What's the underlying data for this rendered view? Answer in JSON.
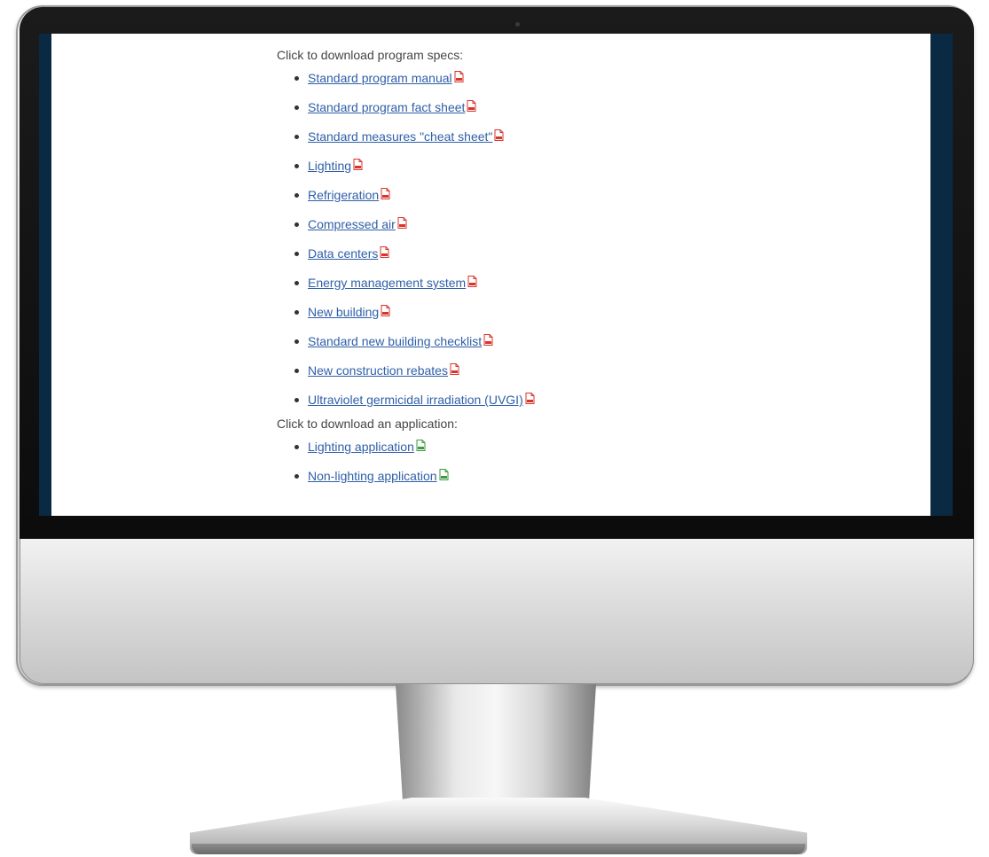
{
  "page": {
    "spec_intro": "Click to download program specs:",
    "application_intro": "Click to download an application:"
  },
  "spec_links": [
    {
      "label": "Standard program manual",
      "icon": "pdf-file-icon"
    },
    {
      "label": "Standard program fact sheet",
      "icon": "pdf-file-icon"
    },
    {
      "label": "Standard measures \"cheat sheet\"",
      "icon": "pdf-file-icon"
    },
    {
      "label": "Lighting",
      "icon": "pdf-file-icon"
    },
    {
      "label": "Refrigeration",
      "icon": "pdf-file-icon"
    },
    {
      "label": "Compressed air",
      "icon": "pdf-file-icon"
    },
    {
      "label": "Data centers",
      "icon": "pdf-file-icon"
    },
    {
      "label": "Energy management system",
      "icon": "pdf-file-icon"
    },
    {
      "label": "New building",
      "icon": "pdf-file-icon"
    },
    {
      "label": "Standard new building checklist",
      "icon": "pdf-file-icon"
    },
    {
      "label": "New construction rebates",
      "icon": "pdf-file-icon"
    },
    {
      "label": "Ultraviolet germicidal irradiation (UVGI)",
      "icon": "pdf-file-icon"
    }
  ],
  "application_links": [
    {
      "label": "Lighting application",
      "icon": "spreadsheet-file-icon"
    },
    {
      "label": "Non-lighting application",
      "icon": "spreadsheet-file-icon"
    }
  ],
  "colors": {
    "link": "#2f5fa8",
    "pdf_icon": "#d9342b",
    "spreadsheet_icon": "#3f9a3f",
    "screen_border": "#0a2a44"
  }
}
